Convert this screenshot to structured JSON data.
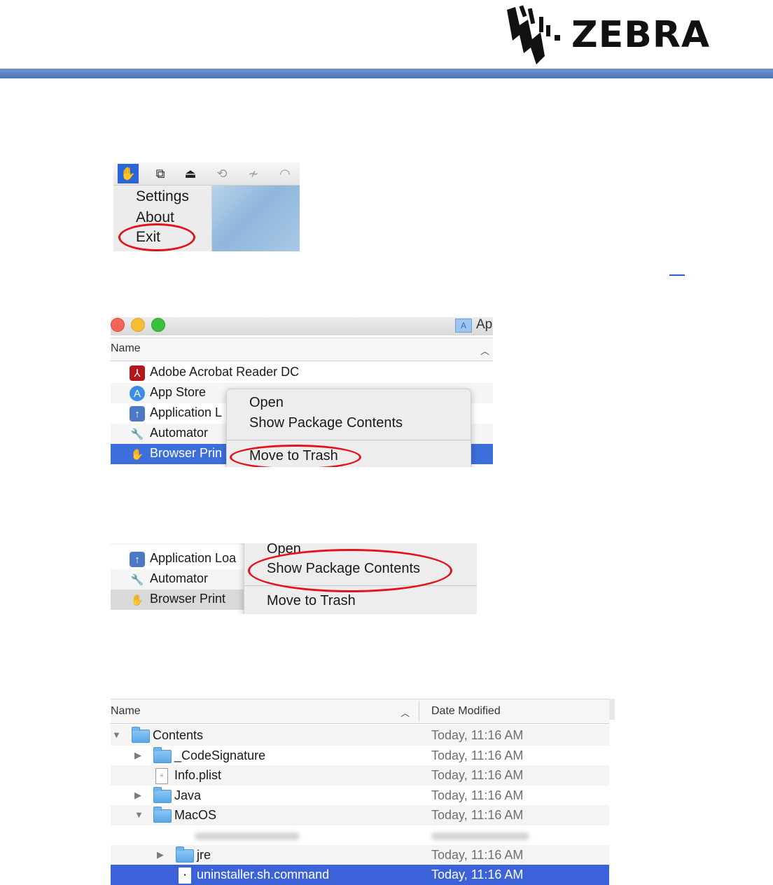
{
  "header": {
    "logo_text": "ZEBRA",
    "brand_color": "#4a76b8"
  },
  "shot1": {
    "menu_items": [
      "Settings",
      "About",
      "Exit"
    ]
  },
  "shot2": {
    "window_title": "Ap",
    "column_name": "Name",
    "rows": [
      "Adobe Acrobat Reader DC",
      "App Store",
      "Application L",
      "Automator",
      "Browser Prin"
    ],
    "context_menu": [
      "Open",
      "Show Package Contents",
      "Move to Trash"
    ]
  },
  "shot3": {
    "rows": [
      "Application Loa",
      "Automator",
      "Browser Print"
    ],
    "context_menu": [
      "Open",
      "Show Package Contents",
      "Move to Trash"
    ]
  },
  "shot4": {
    "column_name": "Name",
    "column_date": "Date Modified",
    "rows": [
      {
        "name": "Contents",
        "date": "Today, 11:16 AM"
      },
      {
        "name": "_CodeSignature",
        "date": "Today, 11:16 AM"
      },
      {
        "name": "Info.plist",
        "date": "Today, 11:16 AM"
      },
      {
        "name": "Java",
        "date": "Today, 11:16 AM"
      },
      {
        "name": "MacOS",
        "date": "Today, 11:16 AM"
      },
      {
        "name": "jre",
        "date": "Today, 11:16 AM"
      },
      {
        "name": "uninstaller.sh.command",
        "date": "Today, 11:16 AM"
      }
    ]
  }
}
